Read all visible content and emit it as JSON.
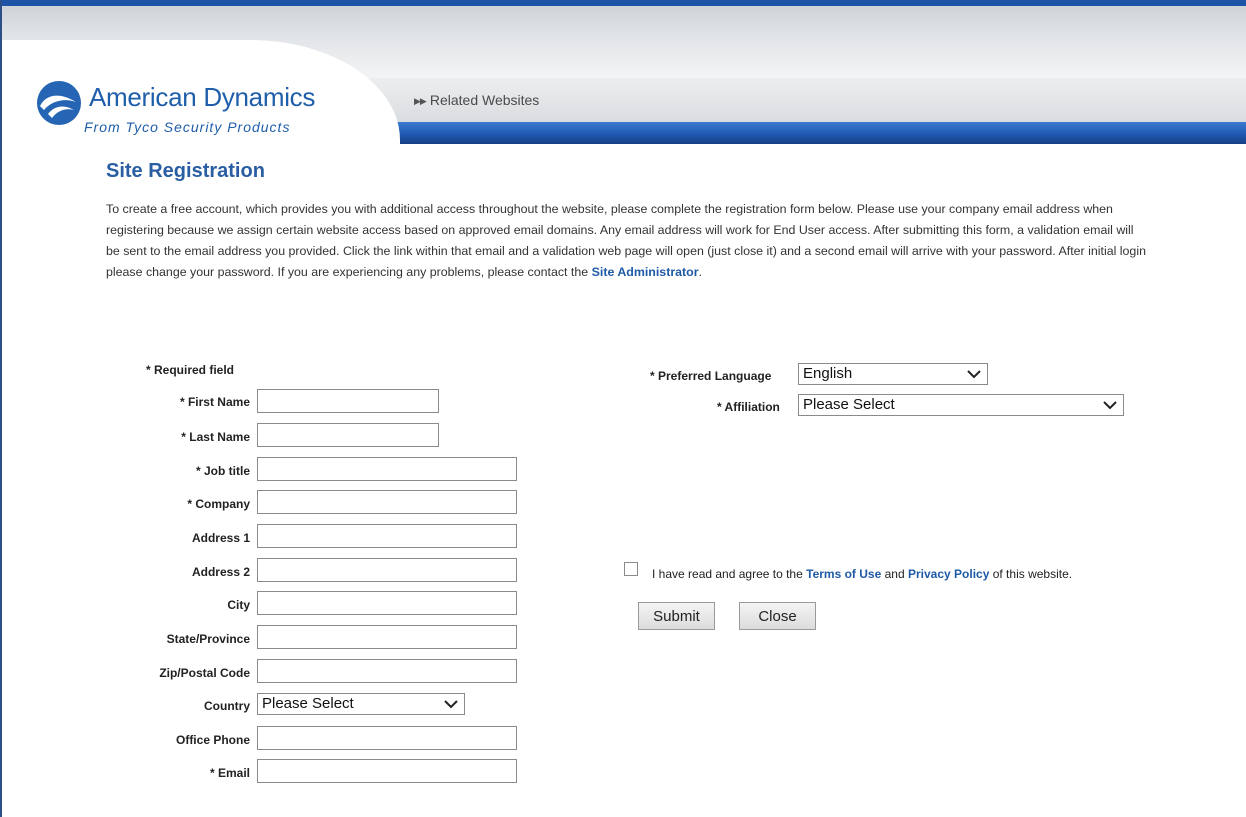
{
  "header": {
    "brand_name": "American Dynamics",
    "brand_tagline": "From Tyco Security Products",
    "related_websites": "Related Websites"
  },
  "page": {
    "title": "Site Registration",
    "intro_text": "To create a free account, which provides you with additional access throughout the website, please complete the registration form below. Please use your company email address when registering because we assign certain website access based on approved email domains. Any email address will work for End User access. After submitting this form, a validation email will be sent to the email address you provided. Click the link within that email and a validation web page will open (just close it) and a second email will arrive with your password. After initial login please change your password. If you are experiencing any problems, please contact the",
    "site_admin_link": "Site Administrator",
    "intro_end": "."
  },
  "form": {
    "required_note": "* Required field",
    "labels": {
      "first_name": "* First Name",
      "last_name": "* Last Name",
      "job_title": "* Job title",
      "company": "* Company",
      "address1": "Address 1",
      "address2": "Address 2",
      "city": "City",
      "state": "State/Province",
      "zip": "Zip/Postal Code",
      "country": "Country",
      "office_phone": "Office Phone",
      "email": "* Email",
      "preferred_language": "* Preferred Language",
      "affiliation": "* Affiliation"
    },
    "values": {
      "first_name": "",
      "last_name": "",
      "job_title": "",
      "company": "",
      "address1": "",
      "address2": "",
      "city": "",
      "state": "",
      "zip": "",
      "office_phone": "",
      "email": ""
    },
    "country_selected": "Please Select",
    "language_selected": "English",
    "affiliation_selected": "Please Select",
    "agree_text_1": "I have read and agree to the",
    "terms_link": "Terms of Use",
    "agree_and": "and",
    "privacy_link": "Privacy Policy",
    "agree_text_2": "of this website.",
    "agree_checked": false,
    "submit_label": "Submit",
    "close_label": "Close"
  },
  "colors": {
    "brand_blue": "#1f5eaa",
    "title_blue": "#2a5ea3",
    "link_blue": "#1f5aa6",
    "header_band_blue": "#1d56ad"
  },
  "icons": {
    "logo": "american-dynamics-logo-icon",
    "related_arrows": "double-chevron-right-icon",
    "dropdown": "chevron-down-icon",
    "checkbox": "checkbox-icon"
  }
}
